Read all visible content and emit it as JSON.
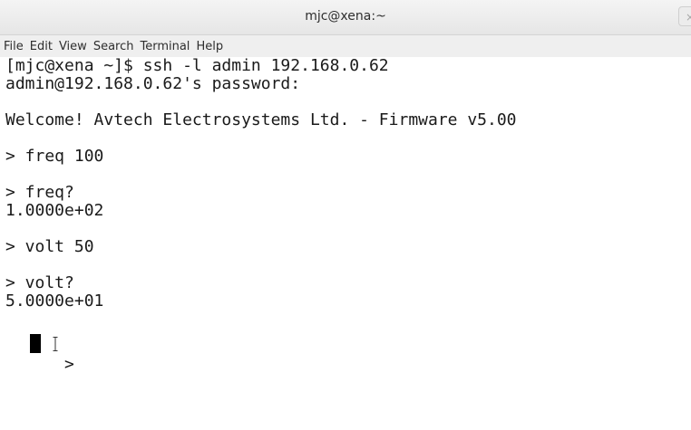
{
  "window": {
    "title": "mjc@xena:~",
    "close_glyph": "×"
  },
  "menu": [
    "File",
    "Edit",
    "View",
    "Search",
    "Terminal",
    "Help"
  ],
  "terminal": {
    "lines": [
      "[mjc@xena ~]$ ssh -l admin 192.168.0.62",
      "admin@192.168.0.62's password:",
      "Welcome! Avtech Electrosystems Ltd. - Firmware v5.00",
      "> freq 100",
      "> freq?",
      "1.0000e+02",
      "> volt 50",
      "> volt?",
      "5.0000e+01",
      ">"
    ]
  }
}
